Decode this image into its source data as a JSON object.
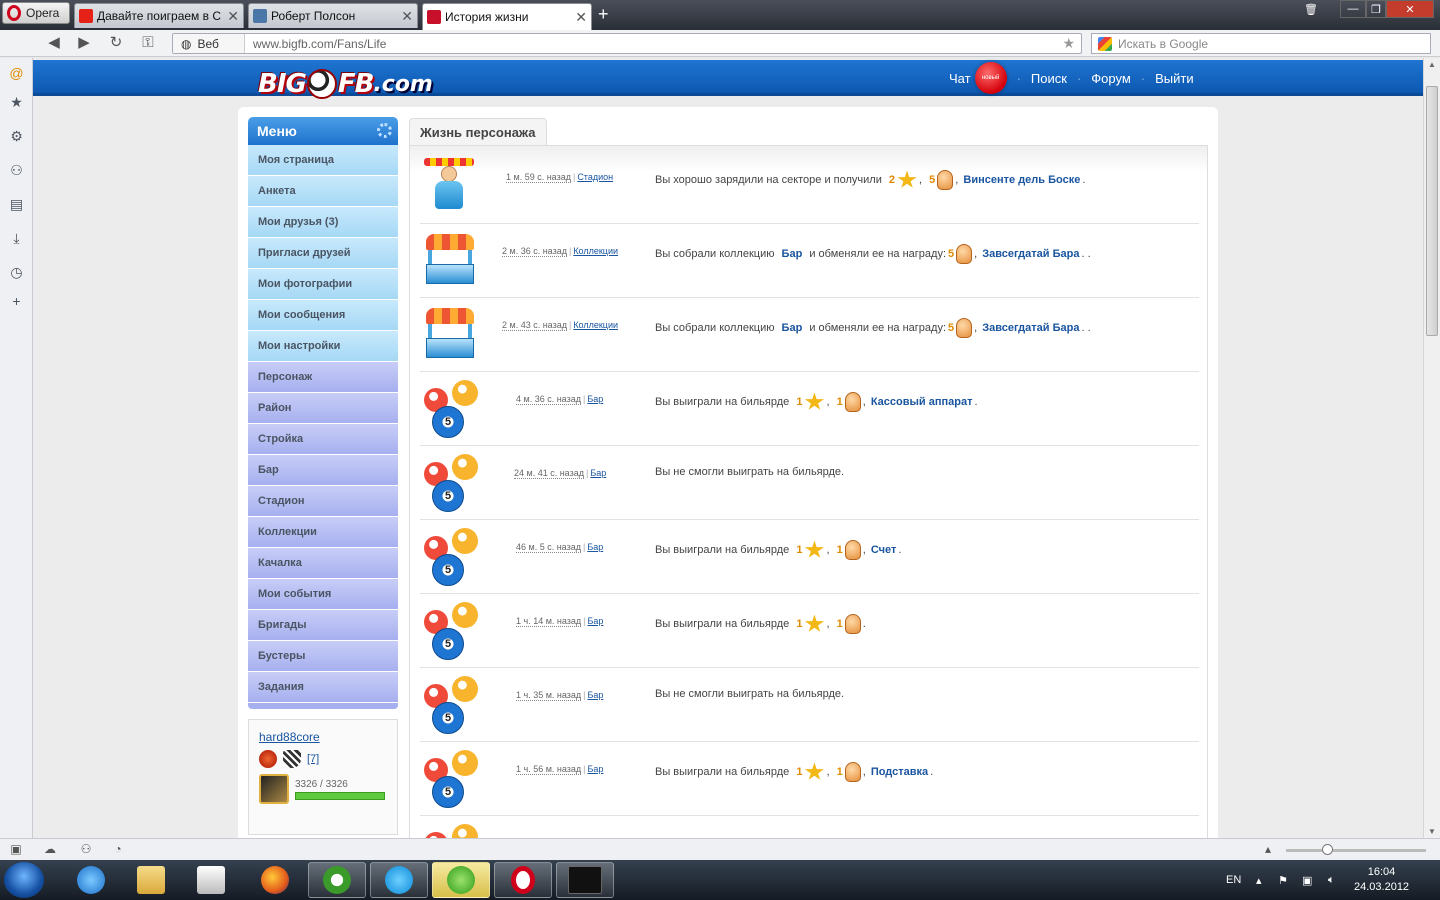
{
  "browser": {
    "opera_label": "Opera",
    "tabs": [
      {
        "label": "Давайте поиграем в С...",
        "color": "#e62117"
      },
      {
        "label": "Роберт Полсон",
        "color": "#4a76a8"
      },
      {
        "label": "История жизни",
        "color": "#c9102a"
      }
    ],
    "address_segment": "Веб",
    "url": "www.bigfb.com/Fans/Life",
    "search_placeholder": "Искать в Google"
  },
  "site": {
    "logo_big": "BIG",
    "logo_fb": "FB",
    "logo_com": ".com",
    "nav": {
      "chat": "Чат",
      "new_badge": "новый",
      "search": "Поиск",
      "forum": "Форум",
      "logout": "Выйти"
    },
    "brand_color": "#1565c0"
  },
  "menu": {
    "title": "Меню",
    "items": [
      "Моя страница",
      "Анкета",
      "Мои друзья (3)",
      "Пригласи друзей",
      "Мои фотографии",
      "Мои сообщения",
      "Мои настройки",
      "Персонаж",
      "Район",
      "Стройка",
      "Бар",
      "Стадион",
      "Коллекции",
      "Качалка",
      "Мои события",
      "Бригады",
      "Бустеры",
      "Задания"
    ]
  },
  "profile": {
    "username": "hard88core",
    "level": "[7]",
    "hp": "3326 / 3326",
    "hp_fraction": 1.0
  },
  "content": {
    "tab_title": "Жизнь персонажа",
    "events": [
      {
        "icon": "fan-icon",
        "time": "1 м. 59 с. назад",
        "location": "Стадион",
        "text": "Вы хорошо зарядили на секторе и получили",
        "n1": "2",
        "sep": ",",
        "n2": "5",
        "link": "Винсенте дель Боске",
        "tail": "."
      },
      {
        "icon": "stall-icon",
        "time": "2 м. 36 с. назад",
        "location": "Коллекции",
        "text": "Вы собрали коллекцию",
        "coll": "Бар",
        "mid": "и обменяли ее на награду:",
        "n2": "5",
        "link": "Завсегдатай Бара",
        "tail": ". ."
      },
      {
        "icon": "stall-icon",
        "time": "2 м. 43 с. назад",
        "location": "Коллекции",
        "text": "Вы собрали коллекцию",
        "coll": "Бар",
        "mid": "и обменяли ее на награду:",
        "n2": "5",
        "link": "Завсегдатай Бара",
        "tail": ". ."
      },
      {
        "icon": "billiard-icon",
        "time": "4 м. 36 с. назад",
        "location": "Бар",
        "text": "Вы выиграли на бильярде",
        "n1": "1",
        "sep": ",",
        "n2": "1",
        "link": "Кассовый аппарат",
        "tail": "."
      },
      {
        "icon": "billiard-icon",
        "time": "24 м. 41 с. назад",
        "location": "Бар",
        "text": "Вы не смогли выиграть на бильярде."
      },
      {
        "icon": "billiard-icon",
        "time": "46 м. 5 с. назад",
        "location": "Бар",
        "text": "Вы выиграли на бильярде",
        "n1": "1",
        "sep": ",",
        "n2": "1",
        "link": "Счет",
        "tail": "."
      },
      {
        "icon": "billiard-icon",
        "time": "1 ч. 14 м. назад",
        "location": "Бар",
        "text": "Вы выиграли на бильярде",
        "n1": "1",
        "sep": ",",
        "n2": "1",
        "link": "",
        "tail": "."
      },
      {
        "icon": "billiard-icon",
        "time": "1 ч. 35 м. назад",
        "location": "Бар",
        "text": "Вы не смогли выиграть на бильярде."
      },
      {
        "icon": "billiard-icon",
        "time": "1 ч. 56 м. назад",
        "location": "Бар",
        "text": "Вы выиграли на бильярде",
        "n1": "1",
        "sep": ",",
        "n2": "1",
        "link": "Подставка",
        "tail": "."
      }
    ]
  },
  "taskbar": {
    "lang": "EN",
    "time": "16:04",
    "date": "24.03.2012"
  }
}
